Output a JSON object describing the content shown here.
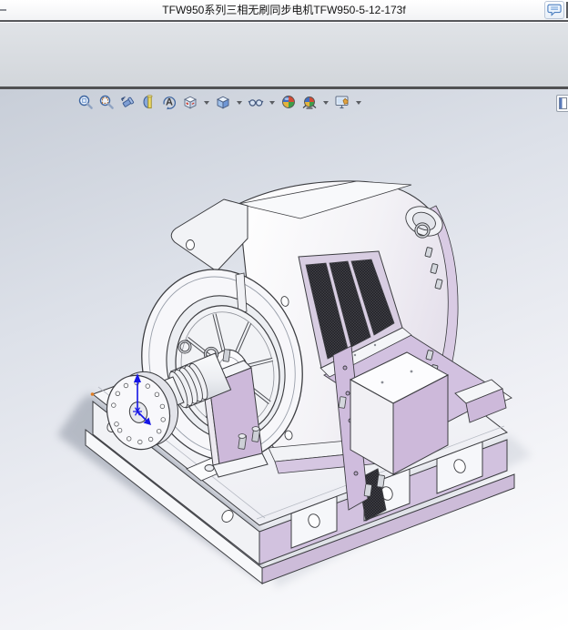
{
  "window": {
    "title": "TFW950系列三相无刷同步电机TFW950-5-12-173f"
  },
  "titlebar": {
    "comments_icon": "speech-bubble-icon",
    "clipped_control": "partial-button"
  },
  "heads_up_toolbar": [
    {
      "name": "zoom-to-fit",
      "icon": "magnifier-icon",
      "has_dropdown": false
    },
    {
      "name": "zoom-to-area",
      "icon": "magnifier-area-icon",
      "has_dropdown": false
    },
    {
      "name": "previous-view",
      "icon": "telescope-back-icon",
      "has_dropdown": false
    },
    {
      "name": "section-view",
      "icon": "section-cut-icon",
      "has_dropdown": false
    },
    {
      "name": "dynamic-annotation-views",
      "icon": "rotate-a-icon",
      "has_dropdown": false
    },
    {
      "name": "view-orientation",
      "icon": "view-cube-icon",
      "has_dropdown": true
    },
    {
      "name": "display-style",
      "icon": "shaded-cube-icon",
      "has_dropdown": true
    },
    {
      "name": "hide-show-items",
      "icon": "eyeglasses-icon",
      "has_dropdown": true
    },
    {
      "name": "edit-appearance",
      "icon": "color-ball-icon",
      "has_dropdown": false
    },
    {
      "name": "apply-scene",
      "icon": "scene-ball-icon",
      "has_dropdown": true
    },
    {
      "name": "view-settings",
      "icon": "monitor-hand-icon",
      "has_dropdown": true
    }
  ],
  "task_pane": {
    "collapsed_tab_icon": "panel-icon"
  },
  "model": {
    "parts": [
      "base-skid",
      "motor-housing",
      "ventilation-grille",
      "terminal-box",
      "spoked-wheel",
      "shaft",
      "coupling-flange",
      "bearing-pedestal",
      "rear-bearing",
      "origin-triad"
    ],
    "origin_triad_color": "#1515e6"
  },
  "colors": {
    "viewport_top": "#c8ced8",
    "viewport_bottom": "#ffffff",
    "accent_lavender": "#cdb9da",
    "mesh_dark": "#26262b",
    "band_gray": "#d7dade",
    "separator": "#515254",
    "shadow": "#858d9b",
    "vertex_highlight": "#e07b1f"
  }
}
